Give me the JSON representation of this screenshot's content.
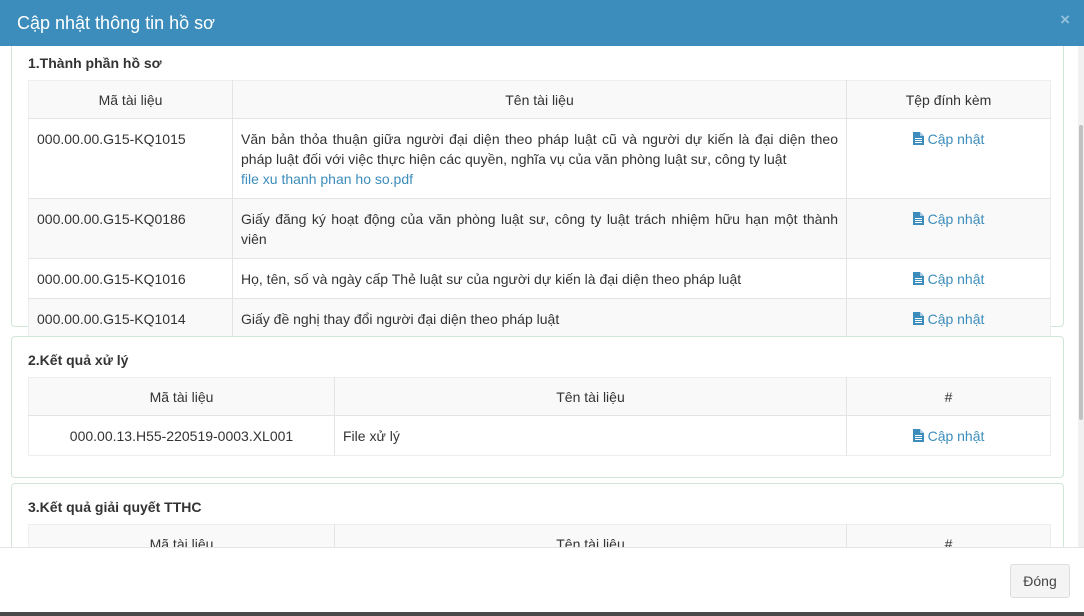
{
  "modal": {
    "title": "Cập nhật thông tin hồ sơ",
    "close_symbol": "×"
  },
  "section1": {
    "title": "1.Thành phần hồ sơ",
    "headers": [
      "Mã tài liệu",
      "Tên tài liệu",
      "Tệp đính kèm"
    ],
    "rows": [
      {
        "code": "000.00.00.G15-KQ1015",
        "name": "Văn bản thỏa thuận giữa người đại diện theo pháp luật cũ và người dự kiến là đại diện theo pháp luật đối với việc thực hiện các quyền, nghĩa vụ của văn phòng luật sư, công ty luật",
        "file": "file xu thanh phan ho so.pdf",
        "action": "Cập nhật"
      },
      {
        "code": "000.00.00.G15-KQ0186",
        "name": "Giấy đăng ký hoạt động của văn phòng luật sư, công ty luật trách nhiệm hữu hạn một thành viên",
        "action": "Cập nhật"
      },
      {
        "code": "000.00.00.G15-KQ1016",
        "name": "Họ, tên, số và ngày cấp Thẻ luật sư của người dự kiến là đại diện theo pháp luật",
        "action": "Cập nhật"
      },
      {
        "code": "000.00.00.G15-KQ1014",
        "name": "Giấy đề nghị thay đổi người đại diện theo pháp luật",
        "action": "Cập nhật"
      }
    ]
  },
  "section2": {
    "title": "2.Kết quả xử lý",
    "headers": [
      "Mã tài liệu",
      "Tên tài liệu",
      "#"
    ],
    "rows": [
      {
        "code": "000.00.13.H55-220519-0003.XL001",
        "name": "File xử lý",
        "action": "Cập nhật"
      }
    ]
  },
  "section3": {
    "title": "3.Kết quả giải quyết TTHC",
    "headers": [
      "Mã tài liệu",
      "Tên tài liệu",
      "#"
    ]
  },
  "footer": {
    "close_label": "Đóng"
  },
  "colors": {
    "header_bg": "#3c8dbc",
    "link": "#3c8dbc"
  },
  "icons": {
    "update": "file-text-icon"
  }
}
